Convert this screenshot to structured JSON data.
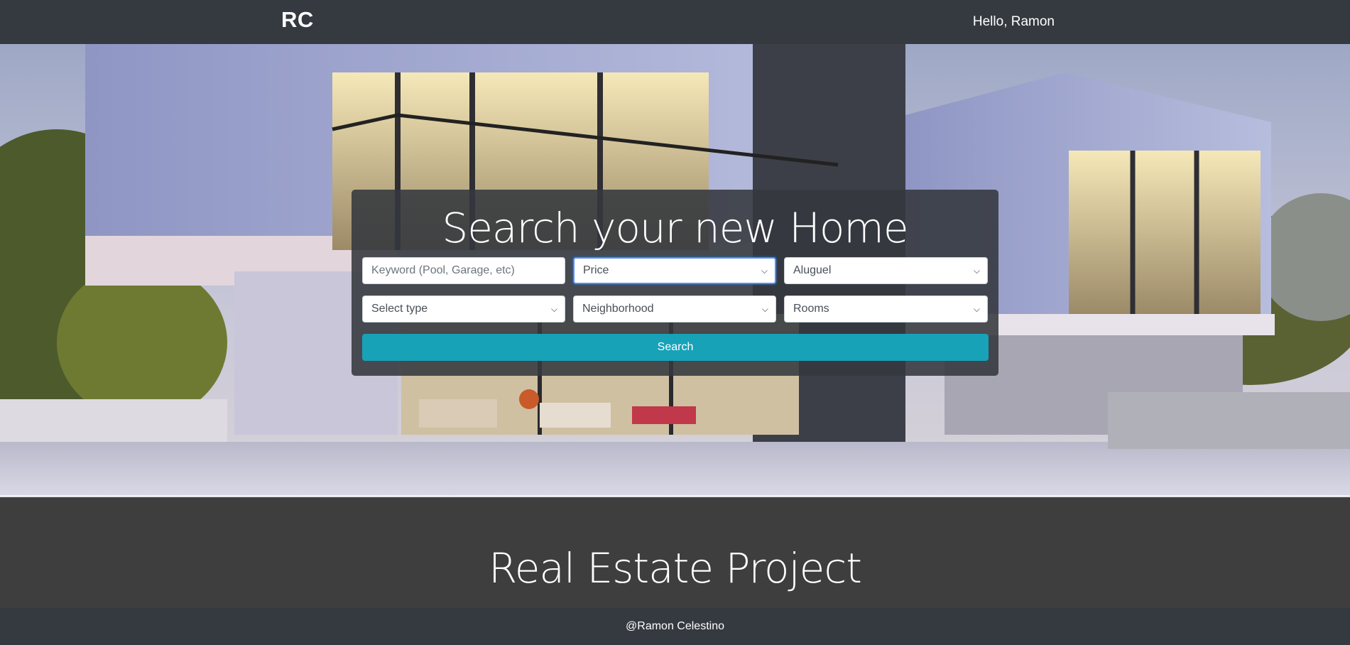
{
  "navbar": {
    "brand": "RC",
    "greeting": "Hello, Ramon"
  },
  "hero": {
    "background": "modern-house-photo",
    "search": {
      "title": "Search your new Home",
      "keyword_placeholder": "Keyword (Pool, Garage, etc)",
      "price": "Price",
      "listing_type": "Aluguel",
      "property_type": "Select type",
      "neighborhood": "Neighborhood",
      "rooms": "Rooms",
      "button_label": "Search"
    }
  },
  "section": {
    "title": "Real Estate Project"
  },
  "footer": {
    "text": "@Ramon Celestino"
  },
  "colors": {
    "navbar": "#343a40",
    "accent": "#17a2b8",
    "section": "#3e3e3e"
  }
}
